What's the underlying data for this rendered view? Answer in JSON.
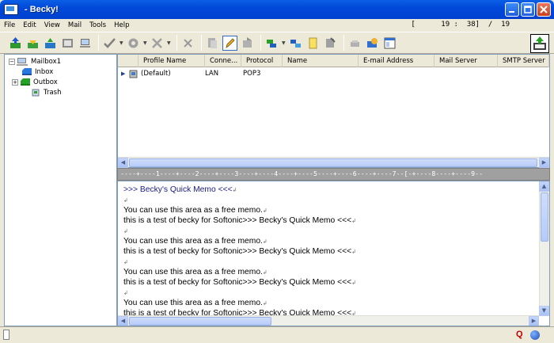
{
  "window": {
    "title": "- Becky!"
  },
  "menu": [
    "File",
    "Edit",
    "View",
    "Mail",
    "Tools",
    "Help"
  ],
  "counter": "[      19 :  38]  /  19",
  "toolbar": {
    "icons": [
      "receive-mail-icon",
      "receive-all-icon",
      "send-icon",
      "address-book-icon",
      "computer-icon",
      "check-spelling-icon",
      "filter-icon",
      "tools-icon",
      "delete-icon",
      "move-icon",
      "edit-icon",
      "forward-icon",
      "folder-icon",
      "connect-icon",
      "note-icon",
      "compose-icon",
      "trash-icon",
      "mailbox-icon",
      "window-icon",
      "memo-icon"
    ]
  },
  "tree": {
    "items": [
      {
        "label": "Mailbox1",
        "icon": "computer-icon"
      },
      {
        "label": "Inbox",
        "icon": "inbox-icon"
      },
      {
        "label": "Outbox",
        "icon": "outbox-icon"
      },
      {
        "label": "Trash",
        "icon": "trash-icon"
      }
    ]
  },
  "list": {
    "columns": [
      "Profile Name",
      "Conne...",
      "Protocol",
      "Name",
      "E-mail Address",
      "Mail Server",
      "SMTP Server"
    ],
    "rows": [
      {
        "profile": "(Default)",
        "connection": "LAN",
        "protocol": "POP3",
        "name": "",
        "email": "",
        "mail_server": "",
        "smtp_server": ""
      }
    ]
  },
  "ruler": "----+----1----+----2----+----3----+----4----+----5----+----6----+----7--[-+----8----+----9--",
  "memo": {
    "title": ">>> Becky's Quick Memo <<<",
    "lines": [
      "",
      "You can use this area as a free memo.",
      "this is a test of becky for Softonic>>> Becky's Quick Memo <<<",
      "",
      "You can use this area as a free memo.",
      "this is a test of becky for Softonic>>> Becky's Quick Memo <<<",
      "",
      "You can use this area as a free memo.",
      "this is a test of becky for Softonic>>> Becky's Quick Memo <<<",
      "",
      "You can use this area as a free memo.",
      "this is a test of becky for Softonic>>> Becky's Quick Memo <<<"
    ]
  },
  "colors": {
    "titlebar": "#0a5fe6",
    "chrome": "#ece9d8",
    "memo_title": "#1a1a8a",
    "ruler": "#a0a0a0"
  }
}
